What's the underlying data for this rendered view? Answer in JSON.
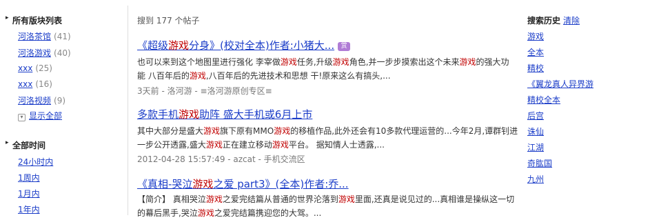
{
  "filters": {
    "forums_title": "所有版块列表",
    "forums": [
      {
        "label": "河洛茶馆",
        "count": "(41)"
      },
      {
        "label": "河洛游戏",
        "count": "(40)"
      },
      {
        "label": "xxx",
        "count": "(25)"
      },
      {
        "label": "xxx",
        "count": "(16)"
      },
      {
        "label": "河洛视频",
        "count": "(9)"
      }
    ],
    "show_all": "显示全部",
    "time_title": "全部时间",
    "times": [
      "24小时内",
      "1周内",
      "1月内",
      "1年内"
    ]
  },
  "results_count": "搜到 177 个帖子",
  "results": [
    {
      "title_parts": [
        "《超级",
        "游戏",
        "分身》(校对全本)作者:小猪大..."
      ],
      "badge": "赏",
      "snippet_lines": [
        [
          "也可以来到这个地图里进行强化 李宰做",
          "游戏",
          "任务,升级",
          "游戏",
          "角色,并一步步摸索出这个未来",
          "游戏",
          "的强大功"
        ],
        [
          "能 八百年后的",
          "游戏",
          ",八百年后的先进技术和思想 干!原来这么有搞头,..."
        ]
      ],
      "meta": "3天前 - 洛河游 - ≡洛河游原创专区≡"
    },
    {
      "title_parts": [
        "多款手机",
        "游戏",
        "助阵 盛大手机或6月上市"
      ],
      "badge": "",
      "snippet_lines": [
        [
          "其中大部分是盛大",
          "游戏",
          "旗下原有MMO",
          "游戏",
          "的移植作品,此外还会有10多款代理运营的...今年2月,谭群钊进"
        ],
        [
          "一步公开透露,盛大",
          "游戏",
          "正在建立移动",
          "游戏",
          "平台。 据知情人士透露,..."
        ]
      ],
      "meta": "2012-04-28 15:57:49 - azcat - 手机交流区"
    },
    {
      "title_parts": [
        "《真相-哭泣",
        "游戏",
        "之爱 part3》(全本)作者:乔..."
      ],
      "badge": "",
      "snippet_lines": [
        [
          "【简介】 真相哭泣",
          "游戏",
          "之爱完结篇从普通的世界沦落到",
          "游戏",
          "里面,还真是说见过的...真相谁是操纵这一切"
        ],
        [
          "的幕后黑手,哭泣",
          "游戏",
          "之爱完结篇携迎您的大驾。..."
        ]
      ],
      "meta": ""
    }
  ],
  "history": {
    "title": "搜索历史",
    "clear": "清除",
    "items": [
      "游戏",
      "全本",
      "精校",
      "《翼龙真人异界游",
      "精校全本",
      "后宫",
      "诛仙",
      "江湖",
      "奇肱国",
      "九州"
    ]
  },
  "colors": {
    "link": "#1a3cc8",
    "keyword": "#c00000",
    "badge": "#b07cd6"
  }
}
